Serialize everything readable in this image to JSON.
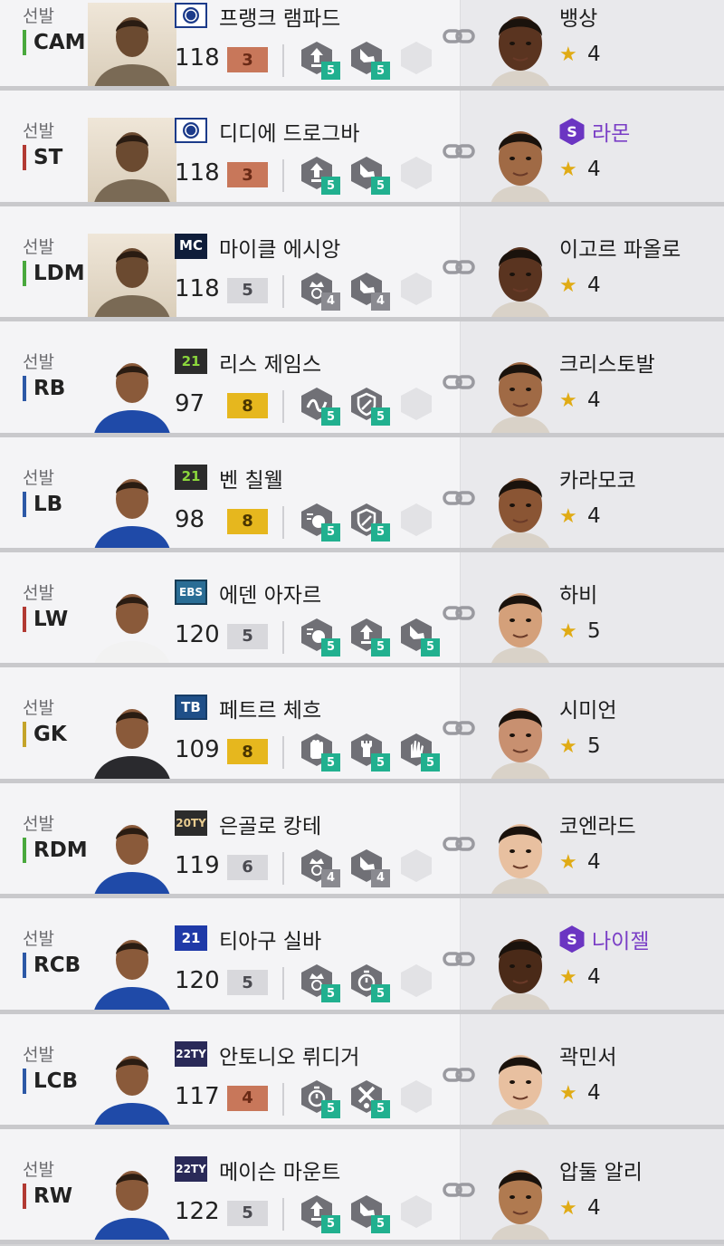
{
  "players": [
    {
      "slot": "선발",
      "position": "CAM",
      "pos_color": "green",
      "season": {
        "label": "",
        "style": "chelsea"
      },
      "name": "프랭크 램파드",
      "ovr": "118",
      "grade": "3",
      "grade_tier": "bronze",
      "photo": "icon",
      "traits": [
        {
          "icon": "shot-up-icon",
          "level": "5",
          "tier": "teal"
        },
        {
          "icon": "boot-icon",
          "level": "5",
          "tier": "teal"
        },
        {
          "icon": "empty-slot-icon",
          "level": "",
          "tier": "empty"
        }
      ],
      "coach": {
        "name": "뱅상",
        "stars": "4",
        "special": false,
        "skin": "#5a3420"
      }
    },
    {
      "slot": "선발",
      "position": "ST",
      "pos_color": "red",
      "season": {
        "label": "",
        "style": "chelsea"
      },
      "name": "디디에 드로그바",
      "ovr": "118",
      "grade": "3",
      "grade_tier": "bronze",
      "photo": "icon",
      "traits": [
        {
          "icon": "shot-up-icon",
          "level": "5",
          "tier": "teal"
        },
        {
          "icon": "boot-icon",
          "level": "5",
          "tier": "teal"
        },
        {
          "icon": "empty-slot-icon",
          "level": "",
          "tier": "empty"
        }
      ],
      "coach": {
        "name": "라몬",
        "stars": "4",
        "special": true,
        "skin": "#a06a45"
      }
    },
    {
      "slot": "선발",
      "position": "LDM",
      "pos_color": "green",
      "season": {
        "label": "MC",
        "style": "mc"
      },
      "name": "마이클 에시앙",
      "ovr": "118",
      "grade": "5",
      "grade_tier": "silver",
      "photo": "icon",
      "traits": [
        {
          "icon": "crown-icon",
          "level": "4",
          "tier": "gray"
        },
        {
          "icon": "boot-icon",
          "level": "4",
          "tier": "gray"
        },
        {
          "icon": "empty-slot-icon",
          "level": "",
          "tier": "empty"
        }
      ],
      "coach": {
        "name": "이고르 파올로",
        "stars": "4",
        "special": false,
        "skin": "#5a3420"
      }
    },
    {
      "slot": "선발",
      "position": "RB",
      "pos_color": "blue",
      "season": {
        "label": "21",
        "style": "s21"
      },
      "name": "리스 제임스",
      "ovr": "97",
      "grade": "8",
      "grade_tier": "gold",
      "photo": "blue",
      "traits": [
        {
          "icon": "wave-icon",
          "level": "5",
          "tier": "teal"
        },
        {
          "icon": "shield-icon",
          "level": "5",
          "tier": "teal"
        },
        {
          "icon": "empty-slot-icon",
          "level": "",
          "tier": "empty"
        }
      ],
      "coach": {
        "name": "크리스토발",
        "stars": "4",
        "special": false,
        "skin": "#a06a45"
      }
    },
    {
      "slot": "선발",
      "position": "LB",
      "pos_color": "blue",
      "season": {
        "label": "21",
        "style": "s21"
      },
      "name": "벤 칠웰",
      "ovr": "98",
      "grade": "8",
      "grade_tier": "gold",
      "photo": "blue",
      "traits": [
        {
          "icon": "ball-speed-icon",
          "level": "5",
          "tier": "teal"
        },
        {
          "icon": "shield-icon",
          "level": "5",
          "tier": "teal"
        },
        {
          "icon": "empty-slot-icon",
          "level": "",
          "tier": "empty"
        }
      ],
      "coach": {
        "name": "카라모코",
        "stars": "4",
        "special": false,
        "skin": "#8a5534"
      }
    },
    {
      "slot": "선발",
      "position": "LW",
      "pos_color": "red",
      "season": {
        "label": "EBS",
        "style": "ebs"
      },
      "name": "에덴 아자르",
      "ovr": "120",
      "grade": "5",
      "grade_tier": "silver",
      "photo": "white",
      "traits": [
        {
          "icon": "ball-speed-icon",
          "level": "5",
          "tier": "teal"
        },
        {
          "icon": "shot-up-icon",
          "level": "5",
          "tier": "teal"
        },
        {
          "icon": "boot-icon",
          "level": "5",
          "tier": "teal"
        }
      ],
      "coach": {
        "name": "하비",
        "stars": "5",
        "special": false,
        "skin": "#d4a07a"
      }
    },
    {
      "slot": "선발",
      "position": "GK",
      "pos_color": "gold",
      "season": {
        "label": "TB",
        "style": "tb"
      },
      "name": "페트르 체흐",
      "ovr": "109",
      "grade": "8",
      "grade_tier": "gold",
      "photo": "dark",
      "traits": [
        {
          "icon": "glove-icon",
          "level": "5",
          "tier": "teal"
        },
        {
          "icon": "tower-icon",
          "level": "5",
          "tier": "teal"
        },
        {
          "icon": "hand-icon",
          "level": "5",
          "tier": "teal"
        }
      ],
      "coach": {
        "name": "시미언",
        "stars": "5",
        "special": false,
        "skin": "#c89070"
      }
    },
    {
      "slot": "선발",
      "position": "RDM",
      "pos_color": "green",
      "season": {
        "label": "20TY",
        "style": "ty20"
      },
      "name": "은골로 캉테",
      "ovr": "119",
      "grade": "6",
      "grade_tier": "silver",
      "photo": "blue",
      "traits": [
        {
          "icon": "crown-icon",
          "level": "4",
          "tier": "gray"
        },
        {
          "icon": "boot-icon",
          "level": "4",
          "tier": "gray"
        },
        {
          "icon": "empty-slot-icon",
          "level": "",
          "tier": "empty"
        }
      ],
      "coach": {
        "name": "코엔라드",
        "stars": "4",
        "special": false,
        "skin": "#e8c0a0"
      }
    },
    {
      "slot": "선발",
      "position": "RCB",
      "pos_color": "blue",
      "season": {
        "label": "21",
        "style": "s21b"
      },
      "name": "티아구 실바",
      "ovr": "120",
      "grade": "5",
      "grade_tier": "silver",
      "photo": "blue",
      "traits": [
        {
          "icon": "crown-icon",
          "level": "5",
          "tier": "teal"
        },
        {
          "icon": "timer-icon",
          "level": "5",
          "tier": "teal"
        },
        {
          "icon": "empty-slot-icon",
          "level": "",
          "tier": "empty"
        }
      ],
      "coach": {
        "name": "나이젤",
        "stars": "4",
        "special": true,
        "skin": "#4a2a18"
      }
    },
    {
      "slot": "선발",
      "position": "LCB",
      "pos_color": "blue",
      "season": {
        "label": "22TY",
        "style": "ty22"
      },
      "name": "안토니오 뤼디거",
      "ovr": "117",
      "grade": "4",
      "grade_tier": "bronze",
      "photo": "blue",
      "traits": [
        {
          "icon": "timer-icon",
          "level": "5",
          "tier": "teal"
        },
        {
          "icon": "tackle-icon",
          "level": "5",
          "tier": "teal"
        },
        {
          "icon": "empty-slot-icon",
          "level": "",
          "tier": "empty"
        }
      ],
      "coach": {
        "name": "곽민서",
        "stars": "4",
        "special": false,
        "skin": "#e8c0a0"
      }
    },
    {
      "slot": "선발",
      "position": "RW",
      "pos_color": "red",
      "season": {
        "label": "22TY",
        "style": "ty22"
      },
      "name": "메이슨 마운트",
      "ovr": "122",
      "grade": "5",
      "grade_tier": "silver",
      "photo": "blue",
      "traits": [
        {
          "icon": "shot-up-icon",
          "level": "5",
          "tier": "teal"
        },
        {
          "icon": "boot-icon",
          "level": "5",
          "tier": "teal"
        },
        {
          "icon": "empty-slot-icon",
          "level": "",
          "tier": "empty"
        }
      ],
      "coach": {
        "name": "압둘 알리",
        "stars": "4",
        "special": false,
        "skin": "#b07a50"
      }
    }
  ],
  "colors": {
    "teal": "#21b08f",
    "gold_grade": "#e6b71e",
    "bronze_grade": "#c8775a",
    "silver_grade": "#d8d8dc",
    "special": "#6b35c2",
    "star": "#e0ab15"
  }
}
